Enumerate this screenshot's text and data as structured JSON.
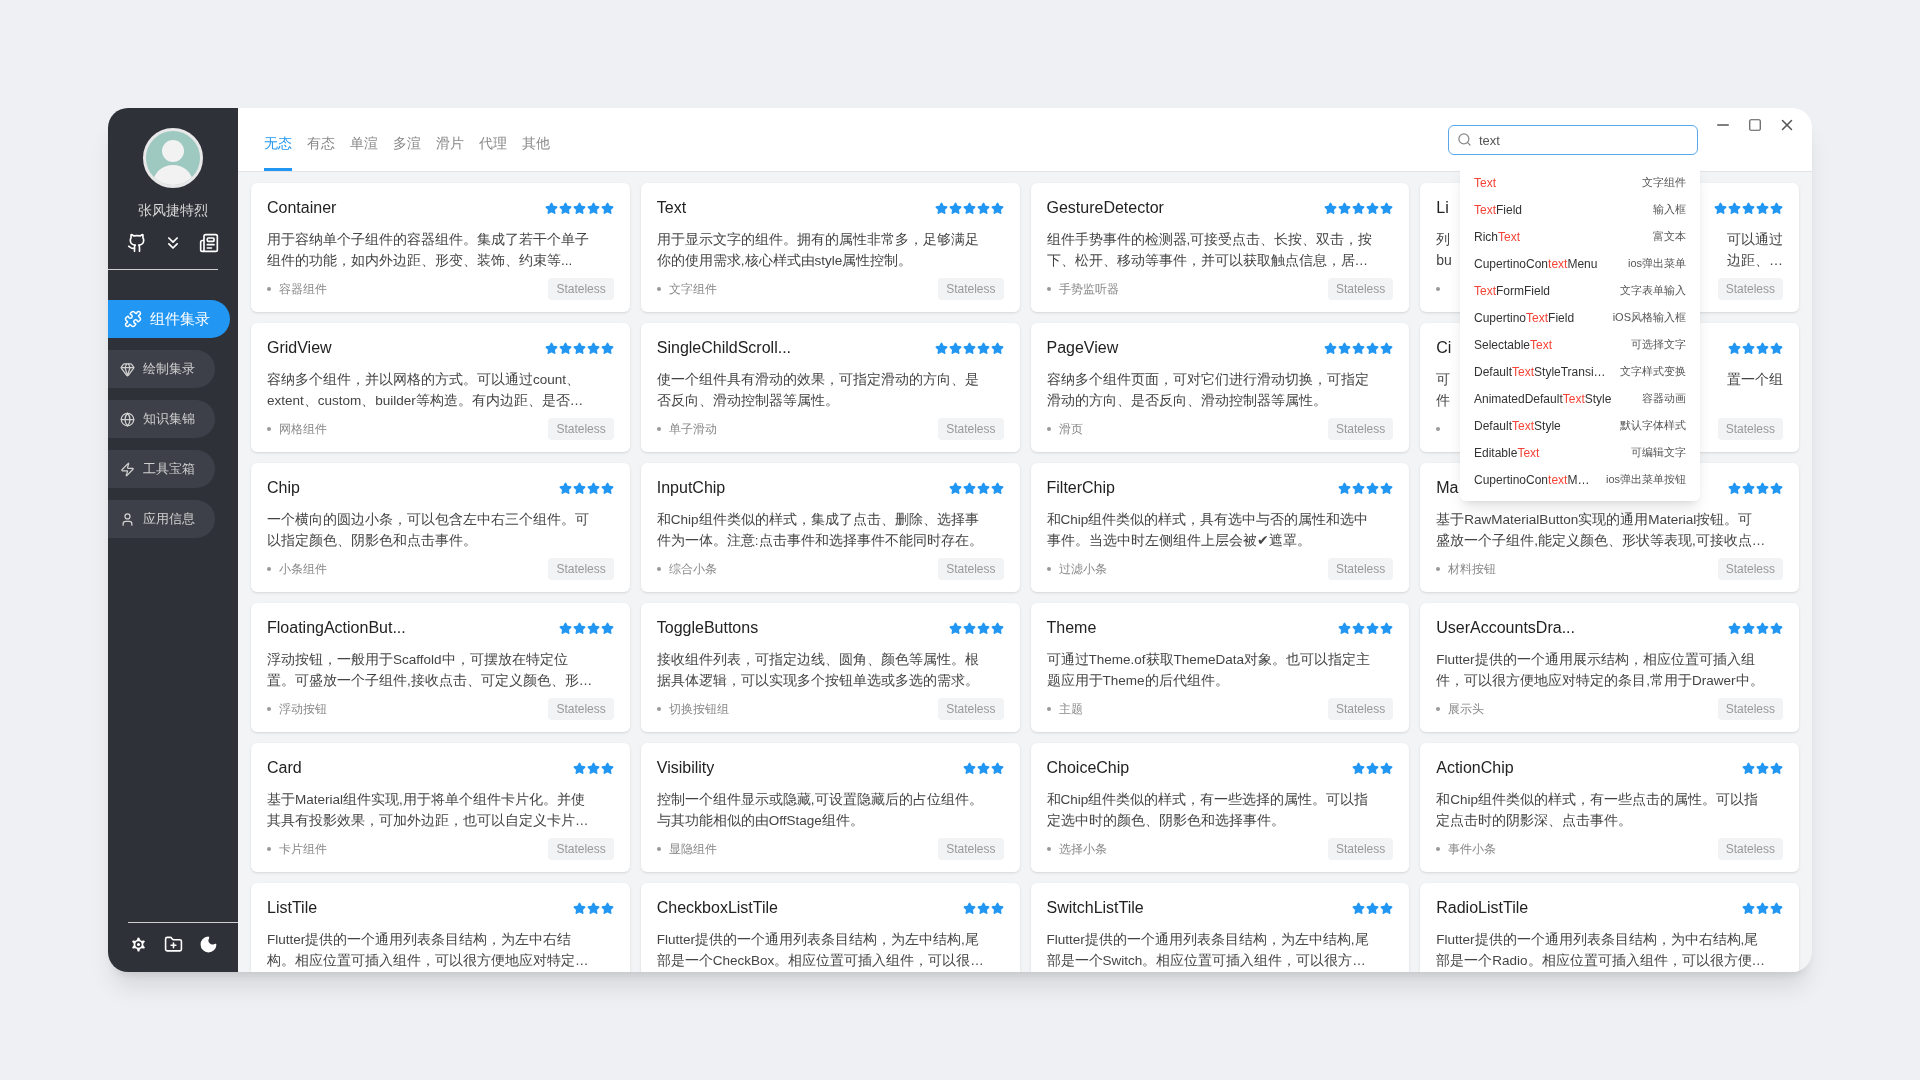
{
  "sidebar": {
    "user_name": "张风捷特烈",
    "nav_items": [
      {
        "label": "组件集录",
        "selected": true
      },
      {
        "label": "绘制集录",
        "selected": false
      },
      {
        "label": "知识集锦",
        "selected": false
      },
      {
        "label": "工具宝箱",
        "selected": false
      },
      {
        "label": "应用信息",
        "selected": false
      }
    ]
  },
  "tabs": [
    {
      "label": "无态",
      "selected": true
    },
    {
      "label": "有态",
      "selected": false
    },
    {
      "label": "单渲",
      "selected": false
    },
    {
      "label": "多渲",
      "selected": false
    },
    {
      "label": "滑片",
      "selected": false
    },
    {
      "label": "代理",
      "selected": false
    },
    {
      "label": "其他",
      "selected": false
    }
  ],
  "search": {
    "value": "text",
    "suggestions": [
      {
        "match": "Text",
        "description": "文字组件"
      },
      {
        "match": "Text",
        "after": "Field",
        "description": "输入框"
      },
      {
        "before": "Rich",
        "match": "Text",
        "description": "富文本"
      },
      {
        "before": "CupertinoCon",
        "match": "text",
        "after": "Menu",
        "description": "ios弹出菜单"
      },
      {
        "match": "Text",
        "after": "FormField",
        "description": "文字表单输入"
      },
      {
        "before": "Cupertino",
        "match": "Text",
        "after": "Field",
        "description": "iOS风格输入框"
      },
      {
        "before": "Selectable",
        "match": "Text",
        "description": "可选择文字"
      },
      {
        "before": "Default",
        "match": "Text",
        "after": "StyleTransi…",
        "description": "文字样式变换"
      },
      {
        "before": "AnimatedDefault",
        "match": "Text",
        "after": "Style",
        "description": "容器动画"
      },
      {
        "before": "Default",
        "match": "Text",
        "after": "Style",
        "description": "默认字体样式"
      },
      {
        "before": "Editable",
        "match": "Text",
        "description": "可编辑文字"
      },
      {
        "before": "CupertinoCon",
        "match": "text",
        "after": "M…",
        "description": "ios弹出菜单按钮"
      }
    ]
  },
  "cards": [
    {
      "kind": "full",
      "title": "Container",
      "stars": 5,
      "lines": [
        "用于容纳单个子组件的容器组件。集成了若干个单子",
        "组件的功能，如内外边距、形变、装饰、约束等..."
      ],
      "tag": "容器组件",
      "badge": "Stateless"
    },
    {
      "kind": "full",
      "title": "Text",
      "stars": 5,
      "lines": [
        "用于显示文字的组件。拥有的属性非常多，足够满足",
        "你的使用需求,核心样式由style属性控制。"
      ],
      "tag": "文字组件",
      "badge": "Stateless"
    },
    {
      "kind": "full",
      "title": "GestureDetector",
      "stars": 5,
      "lines": [
        "组件手势事件的检测器,可接受点击、长按、双击，按",
        "下、松开、移动等事件，并可以获取触点信息，居…"
      ],
      "tag": "手势监听器",
      "badge": "Stateless"
    },
    {
      "kind": "covered",
      "title": "Li",
      "stars": 5,
      "lines_left": [
        "列",
        "bu"
      ],
      "lines_right": [
        "可以通过",
        "边距、…"
      ],
      "badge": "Stateless"
    },
    {
      "kind": "full",
      "title": "GridView",
      "stars": 5,
      "lines": [
        "容纳多个组件，并以网格的方式。可以通过count、",
        "extent、custom、builder等构造。有内边距、是否…"
      ],
      "tag": "网格组件",
      "badge": "Stateless"
    },
    {
      "kind": "full",
      "title": "SingleChildScroll...",
      "stars": 5,
      "lines": [
        "使一个组件具有滑动的效果，可指定滑动的方向、是",
        "否反向、滑动控制器等属性。"
      ],
      "tag": "单子滑动",
      "badge": "Stateless"
    },
    {
      "kind": "full",
      "title": "PageView",
      "stars": 5,
      "lines": [
        "容纳多个组件页面，可对它们进行滑动切换，可指定",
        "滑动的方向、是否反向、滑动控制器等属性。"
      ],
      "tag": "滑页",
      "badge": "Stateless"
    },
    {
      "kind": "covered",
      "title": "Ci",
      "stars": 4,
      "lines_left": [
        "可",
        "件"
      ],
      "lines_right": [
        "置一个组"
      ],
      "badge": "Stateless"
    },
    {
      "kind": "full",
      "title": "Chip",
      "stars": 4,
      "lines": [
        "一个横向的圆边小条，可以包含左中右三个组件。可",
        "以指定颜色、阴影色和点击事件。"
      ],
      "tag": "小条组件",
      "badge": "Stateless"
    },
    {
      "kind": "full",
      "title": "InputChip",
      "stars": 4,
      "lines": [
        "和Chip组件类似的样式，集成了点击、删除、选择事",
        "件为一体。注意:点击事件和选择事件不能同时存在。"
      ],
      "tag": "综合小条",
      "badge": "Stateless"
    },
    {
      "kind": "full",
      "title": "FilterChip",
      "stars": 4,
      "lines": [
        "和Chip组件类似的样式，具有选中与否的属性和选中",
        "事件。当选中时左侧组件上层会被✔遮罩。"
      ],
      "tag": "过滤小条",
      "badge": "Stateless"
    },
    {
      "kind": "full",
      "title": "Ma",
      "stars": 4,
      "lines": [
        "基于RawMaterialButton实现的通用Material按钮。可",
        "盛放一个子组件,能定义颜色、形状等表现,可接收点…"
      ],
      "tag": "材料按钮",
      "badge": "Stateless"
    },
    {
      "kind": "full",
      "title": "FloatingActionBut...",
      "stars": 4,
      "lines": [
        "浮动按钮，一般用于Scaffold中，可摆放在特定位",
        "置。可盛放一个子组件,接收点击、可定义颜色、形…"
      ],
      "tag": "浮动按钮",
      "badge": "Stateless"
    },
    {
      "kind": "full",
      "title": "ToggleButtons",
      "stars": 4,
      "lines": [
        "接收组件列表，可指定边线、圆角、颜色等属性。根",
        "据具体逻辑，可以实现多个按钮单选或多选的需求。"
      ],
      "tag": "切换按钮组",
      "badge": "Stateless"
    },
    {
      "kind": "full",
      "title": "Theme",
      "stars": 4,
      "lines": [
        "可通过Theme.of获取ThemeData对象。也可以指定主",
        "题应用于Theme的后代组件。"
      ],
      "tag": "主题",
      "badge": "Stateless"
    },
    {
      "kind": "full",
      "title": "UserAccountsDra...",
      "stars": 4,
      "lines": [
        "Flutter提供的一个通用展示结构，相应位置可插入组",
        "件，可以很方便地应对特定的条目,常用于Drawer中。"
      ],
      "tag": "展示头",
      "badge": "Stateless"
    },
    {
      "kind": "full",
      "title": "Card",
      "stars": 3,
      "lines": [
        "基于Material组件实现,用于将单个组件卡片化。并使",
        "其具有投影效果，可加外边距，也可以自定义卡片…"
      ],
      "tag": "卡片组件",
      "badge": "Stateless"
    },
    {
      "kind": "full",
      "title": "Visibility",
      "stars": 3,
      "lines": [
        "控制一个组件显示或隐藏,可设置隐藏后的占位组件。",
        "与其功能相似的由OffStage组件。"
      ],
      "tag": "显隐组件",
      "badge": "Stateless"
    },
    {
      "kind": "full",
      "title": "ChoiceChip",
      "stars": 3,
      "lines": [
        "和Chip组件类似的样式，有一些选择的属性。可以指",
        "定选中时的颜色、阴影色和选择事件。"
      ],
      "tag": "选择小条",
      "badge": "Stateless"
    },
    {
      "kind": "full",
      "title": "ActionChip",
      "stars": 3,
      "lines": [
        "和Chip组件类似的样式，有一些点击的属性。可以指",
        "定点击时的阴影深、点击事件。"
      ],
      "tag": "事件小条",
      "badge": "Stateless"
    },
    {
      "kind": "full",
      "title": "ListTile",
      "stars": 3,
      "lines": [
        "Flutter提供的一个通用列表条目结构，为左中右结",
        "构。相应位置可插入组件，可以很方便地应对特定…"
      ]
    },
    {
      "kind": "full",
      "title": "CheckboxListTile",
      "stars": 3,
      "lines": [
        "Flutter提供的一个通用列表条目结构，为左中结构,尾",
        "部是一个CheckBox。相应位置可插入组件，可以很…"
      ]
    },
    {
      "kind": "full",
      "title": "SwitchListTile",
      "stars": 3,
      "lines": [
        "Flutter提供的一个通用列表条目结构，为左中结构,尾",
        "部是一个Switch。相应位置可插入组件，可以很方…"
      ]
    },
    {
      "kind": "full",
      "title": "RadioListTile",
      "stars": 3,
      "lines": [
        "Flutter提供的一个通用列表条目结构，为中右结构,尾",
        "部是一个Radio。相应位置可插入组件，可以很方便…"
      ]
    }
  ]
}
